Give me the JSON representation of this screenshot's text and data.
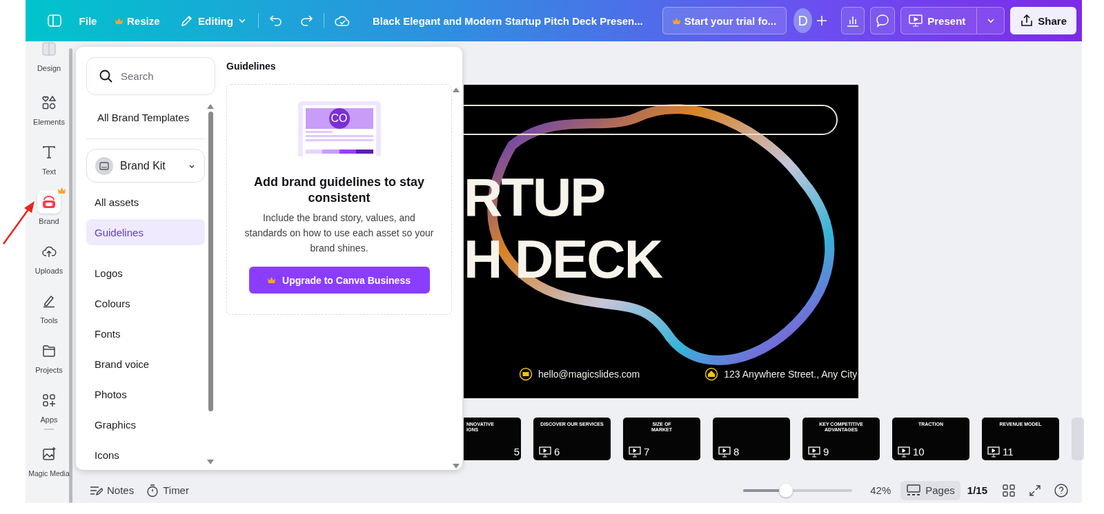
{
  "topbar": {
    "menu": [
      {
        "label": "File",
        "premium": false
      },
      {
        "label": "Resize",
        "premium": true
      }
    ],
    "mode": "Editing",
    "title": "Black Elegant and Modern Startup Pitch Deck Presen...",
    "trial": "Start your trial fo...",
    "avatar": "D",
    "present": "Present",
    "share": "Share"
  },
  "rail": [
    {
      "label": "Design",
      "selected": false,
      "premium": false
    },
    {
      "label": "Elements",
      "selected": false,
      "premium": false
    },
    {
      "label": "Text",
      "selected": false,
      "premium": false
    },
    {
      "label": "Brand",
      "selected": true,
      "premium": true
    },
    {
      "label": "Uploads",
      "selected": false,
      "premium": false
    },
    {
      "label": "Tools",
      "selected": false,
      "premium": false
    },
    {
      "label": "Projects",
      "selected": false,
      "premium": false
    },
    {
      "label": "Apps",
      "selected": false,
      "premium": false
    },
    {
      "label": "Magic Media",
      "selected": false,
      "premium": false
    }
  ],
  "panel": {
    "search": {
      "placeholder": "Search"
    },
    "templates": "All Brand Templates",
    "brand_kit": "Brand Kit",
    "nav_groups": [
      {
        "items": [
          {
            "label": "All assets",
            "selected": false
          },
          {
            "label": "Guidelines",
            "selected": true
          }
        ]
      },
      {
        "items": [
          {
            "label": "Logos",
            "selected": false
          },
          {
            "label": "Colours",
            "selected": false
          },
          {
            "label": "Fonts",
            "selected": false
          },
          {
            "label": "Brand voice",
            "selected": false
          },
          {
            "label": "Photos",
            "selected": false
          },
          {
            "label": "Graphics",
            "selected": false
          },
          {
            "label": "Icons",
            "selected": false
          }
        ]
      }
    ],
    "heading": "Guidelines",
    "illustration_badge": "CO",
    "card": {
      "title": "Add brand guidelines to stay consistent",
      "body": "Include the brand story, values, and standards on how to use each asset so your brand shines.",
      "button": "Upgrade to Canva Business"
    }
  },
  "slide": {
    "title_lines": [
      "RTUP",
      "H DECK"
    ],
    "email": "hello@magicslides.com",
    "address": "123 Anywhere Street., Any City"
  },
  "thumbnails": [
    {
      "kind": "cut",
      "number": "5",
      "title_lines": [
        "NNOVATIVE",
        "IONS"
      ]
    },
    {
      "kind": "full",
      "number": "6",
      "title_lines": [
        "DISCOVER OUR SERVICES"
      ]
    },
    {
      "kind": "full",
      "number": "7",
      "title_lines": [
        "SIZE OF",
        "MARKET"
      ]
    },
    {
      "kind": "full",
      "number": "8"
    },
    {
      "kind": "full",
      "number": "9",
      "title_lines": [
        "KEY COMPETITIVE",
        "ADVANTAGES"
      ]
    },
    {
      "kind": "full",
      "number": "10",
      "title_lines": [
        "TRACTION"
      ]
    },
    {
      "kind": "full",
      "number": "11",
      "title_lines": [
        "REVENUE MODEL"
      ]
    },
    {
      "kind": "faded"
    }
  ],
  "footer": {
    "notes": "Notes",
    "timer": "Timer",
    "zoom": {
      "level": 0.39,
      "reading": "42%"
    },
    "pages": {
      "label": "Pages",
      "selected": true
    },
    "page_count": "1/15"
  }
}
